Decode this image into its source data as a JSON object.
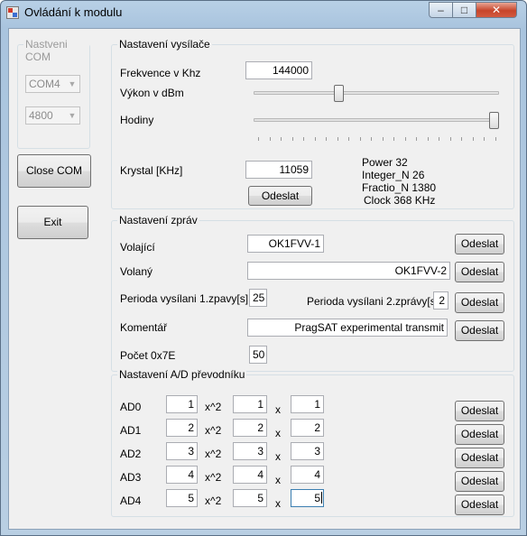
{
  "window": {
    "title": "Ovládání k modulu"
  },
  "com_group": {
    "title": "Nastveni COM",
    "port": "COM4",
    "baud": "4800"
  },
  "left_buttons": {
    "close_com": "Close COM",
    "exit": "Exit"
  },
  "transmitter": {
    "title": "Nastavení vysílače",
    "freq_label": "Frekvence v Khz",
    "freq_value": "144000",
    "power_label": "Výkon v dBm",
    "power_level": 0.34,
    "clock_label": "Hodiny",
    "clock_level": 1.0,
    "crystal_label": "Krystal [KHz]",
    "crystal_value": "11059",
    "send": "Odeslat",
    "info": [
      "Power 32",
      "Integer_N 26",
      "Fractio_N 1380",
      "Clock 368 KHz"
    ]
  },
  "messages": {
    "title": "Nastavení zpráv",
    "caller_label": "Volající",
    "caller_value": "OK1FVV-1",
    "called_label": "Volaný",
    "called_value": "OK1FVV-2",
    "period1_label": "Perioda vysílani 1.zpavy[s]",
    "period1_value": "25",
    "period2_label": "Perioda vysílani 2.zprávy[s]",
    "period2_value": "2",
    "comment_label": "Komentář",
    "comment_value": "PragSAT experimental transmit",
    "count_label": "Počet 0x7E",
    "count_value": "50",
    "send": "Odeslat"
  },
  "ad": {
    "title": "Nastavení A/D převodníku",
    "x2_label": "x^2",
    "x_label": "x",
    "send": "Odeslat",
    "rows": [
      {
        "label": "AD0",
        "a": "1",
        "b": "1",
        "c": "1"
      },
      {
        "label": "AD1",
        "a": "2",
        "b": "2",
        "c": "2"
      },
      {
        "label": "AD2",
        "a": "3",
        "b": "3",
        "c": "3"
      },
      {
        "label": "AD3",
        "a": "4",
        "b": "4",
        "c": "4"
      },
      {
        "label": "AD4",
        "a": "5",
        "b": "5",
        "c": "5"
      }
    ]
  },
  "colors": {
    "title_bar": "#b8d0e6",
    "client": "#f0f0f0",
    "close_button": "#c7452b"
  }
}
